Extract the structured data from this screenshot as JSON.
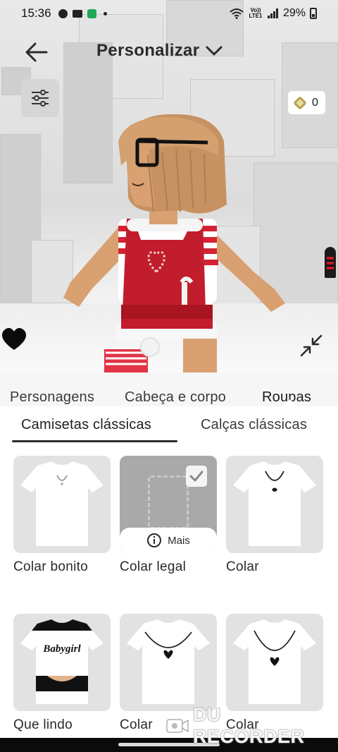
{
  "status_bar": {
    "time": "15:36",
    "network": "Vo)) LTE1",
    "battery": "29%"
  },
  "header": {
    "title": "Personalizar",
    "back_icon": "arrow-left-icon",
    "dropdown_icon": "chevron-down-icon"
  },
  "toolbar": {
    "filter_icon": "sliders-icon",
    "robux_icon": "robux-icon",
    "robux_balance": "0"
  },
  "category_tabs": [
    {
      "label": "Personagens",
      "active": false
    },
    {
      "label": "Cabeça e corpo",
      "active": false
    },
    {
      "label": "Roupas",
      "active": true
    }
  ],
  "sub_tabs": [
    {
      "label": "Camisetas clássicas",
      "active": true
    },
    {
      "label": "Calças clássicas",
      "active": false
    }
  ],
  "items": [
    {
      "label": "Colar bonito",
      "selected": false,
      "art": "shirt-small-necklace"
    },
    {
      "label": "Colar legal",
      "selected": true,
      "art": "placeholder",
      "more_label": "Mais"
    },
    {
      "label": "Colar",
      "selected": false,
      "art": "shirt-dark-necklace"
    },
    {
      "label": "Que lindo",
      "selected": false,
      "art": "shirt-babygirl",
      "shirt_text": "Babygirl"
    },
    {
      "label": "Colar",
      "selected": false,
      "art": "shirt-heart-necklace"
    },
    {
      "label": "Colar",
      "selected": false,
      "art": "shirt-heart-necklace"
    }
  ],
  "watermark": "DU RECORDER",
  "colors": {
    "panel_bg": "#f6f6f6",
    "thumb_bg": "#e2e2e2",
    "selected_bg": "#a9a9a9",
    "accent_red": "#c41a2a"
  }
}
